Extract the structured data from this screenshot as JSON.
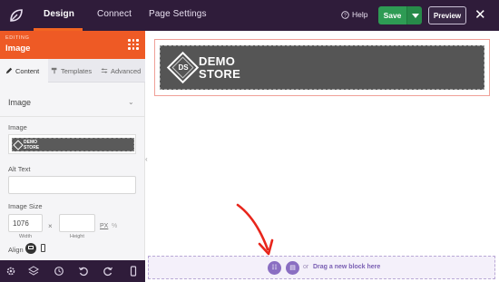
{
  "topbar": {
    "tabs": [
      "Design",
      "Connect",
      "Page Settings"
    ],
    "help_label": "Help",
    "save_label": "Save",
    "preview_label": "Preview",
    "close_glyph": "✕"
  },
  "sidebar": {
    "editing_label": "EDITING",
    "editing_title": "Image",
    "subtabs": [
      "Content",
      "Templates",
      "Advanced"
    ],
    "section_title": "Image",
    "image_label": "Image",
    "thumb_brand": [
      "DEMO",
      "STORE"
    ],
    "alt_text_label": "Alt Text",
    "alt_text_value": "",
    "image_size_label": "Image Size",
    "width_value": "1076",
    "height_value": "",
    "width_caption": "Width",
    "height_caption": "Height",
    "times_glyph": "×",
    "unit_px": "PX",
    "unit_percent": "%",
    "align_label": "Align"
  },
  "canvas": {
    "logo_letters": "DS",
    "brand_line1": "DEMO",
    "brand_line2": "STORE"
  },
  "dropzone": {
    "or_label": "or",
    "drag_label": "Drag a new block here"
  },
  "colors": {
    "topbar": "#2f1c3a",
    "accent_orange": "#ee5a25",
    "save_green": "#2e9b54",
    "purple": "#8a6ec2",
    "arrow_red": "#e8261c"
  }
}
